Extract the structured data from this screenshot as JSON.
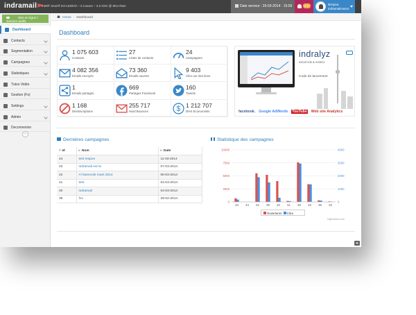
{
  "topbar": {
    "logo": "indramail",
    "cpu": "Intel® Xeon® E3-1230V3 – 4 Coeurs – 3.3 GHz @ 8Go Ram",
    "server_date": "Date serveur : 26-03-2014 - 15:59",
    "notifications": "4-0",
    "user_line1": "Bonjour,",
    "user_line2": "indramailmaroc",
    "accent": "#3a87c8"
  },
  "sidebar": {
    "site_status": "Site en ligne / Service actifs",
    "items": [
      {
        "label": "Dashboard",
        "icon": "dashboard-icon",
        "active": true
      },
      {
        "label": "Contacts",
        "icon": "user-icon",
        "chevron": true
      },
      {
        "label": "Segmentation",
        "icon": "segments-icon",
        "chevron": true
      },
      {
        "label": "Campagnes",
        "icon": "envelope-icon",
        "chevron": true
      },
      {
        "label": "Statistiques",
        "icon": "bar-chart-icon",
        "chevron": true
      },
      {
        "label": "Tutos Vidéo",
        "icon": "video-icon"
      },
      {
        "label": "Gestion (Fs)",
        "icon": "file-icon"
      },
      {
        "label": "Settings",
        "icon": "gear-icon",
        "chevron": true
      },
      {
        "label": "Admin",
        "icon": "monitor-icon",
        "chevron": true
      },
      {
        "label": "Deconnexion",
        "icon": "power-icon"
      }
    ],
    "collapse_icon": "double-chevron-left-icon"
  },
  "breadcrumb": {
    "home": "Home",
    "current": "Dashboard"
  },
  "page_title": "Dashboard",
  "stats": [
    {
      "value": "1 075 603",
      "label": "Contacts",
      "icon": "users-icon",
      "color": "#3a87c8"
    },
    {
      "value": "27",
      "label": "Listes de contacts",
      "icon": "list-icon",
      "color": "#3a87c8"
    },
    {
      "value": "24",
      "label": "Campagnes",
      "icon": "gauge-icon",
      "color": "#3a87c8"
    },
    {
      "value": "4 082 356",
      "label": "Emails envoyés",
      "icon": "envelope-icon",
      "color": "#3a87c8"
    },
    {
      "value": "73 360",
      "label": "Emails ouverts",
      "icon": "open-envelope-icon",
      "color": "#3a87c8"
    },
    {
      "value": "9 403",
      "label": "Clics sur des liens",
      "icon": "pointer-icon",
      "color": "#3a87c8"
    },
    {
      "value": "1",
      "label": "Emails partagés",
      "icon": "share-icon",
      "color": "#3a87c8"
    },
    {
      "value": "669",
      "label": "Partages Facebook",
      "icon": "facebook-icon",
      "color": "#3a87c8"
    },
    {
      "value": "160",
      "label": "Tweets",
      "icon": "twitter-icon",
      "color": "#3a87c8"
    },
    {
      "value": "1 168",
      "label": "Désinscriptions",
      "icon": "ban-icon",
      "color": "#d9534f"
    },
    {
      "value": "255 717",
      "label": "Hard Bounces",
      "icon": "bounce-envelope-icon",
      "color": "#d9534f"
    },
    {
      "value": "1 212 707",
      "label": "DHS Economisés",
      "icon": "dollar-icon",
      "color": "#3a87c8"
    }
  ],
  "promo": {
    "brand": "indralyz",
    "tagline": "social Ads & metrics",
    "launch": "Code de lancement",
    "logos": [
      "facebook.",
      "Google AdWords",
      "YouTube",
      "Web site Analytics"
    ]
  },
  "campaigns": {
    "title": "Dernières campagnes",
    "columns": [
      "Id",
      "Nom",
      "Date"
    ],
    "rows": [
      [
        "44",
        "test respon",
        "11-03-2014"
      ],
      [
        "43",
        "indramail est la",
        "07-03-2014"
      ],
      [
        "42",
        "A?zanecole mars 2014",
        "06-03-2014"
      ],
      [
        "41",
        "test",
        "04-03-2014"
      ],
      [
        "40",
        "indramail",
        "04-03-2014"
      ],
      [
        "39",
        "fev",
        "29-02-2014"
      ]
    ]
  },
  "stats_chart": {
    "title": "Statistique des campagnes",
    "credit": "Highcharts.com"
  },
  "chart_data": {
    "type": "bar",
    "categories": [
      "43",
      "44",
      "42",
      "39",
      "40",
      "41",
      "30",
      "33",
      "35",
      "33"
    ],
    "ylim_left": [
      0,
      10000
    ],
    "yticks_left": [
      "0",
      "2500",
      "5000",
      "7500",
      "10000"
    ],
    "ylim_right": [
      0,
      4000
    ],
    "yticks_right": [
      "0",
      "1000",
      "2000",
      "3000",
      "4000"
    ],
    "series": [
      {
        "name": "Ouvertures",
        "color": "#d9534f",
        "axis": "left",
        "values": [
          700,
          0,
          5500,
          5200,
          4000,
          200,
          7600,
          3400,
          300,
          100
        ]
      },
      {
        "name": "Clics",
        "color": "#4a90e2",
        "axis": "right",
        "values": [
          180,
          0,
          1900,
          1500,
          320,
          60,
          2950,
          1350,
          100,
          20
        ]
      }
    ],
    "legend": "bottom-center",
    "grid": true
  }
}
